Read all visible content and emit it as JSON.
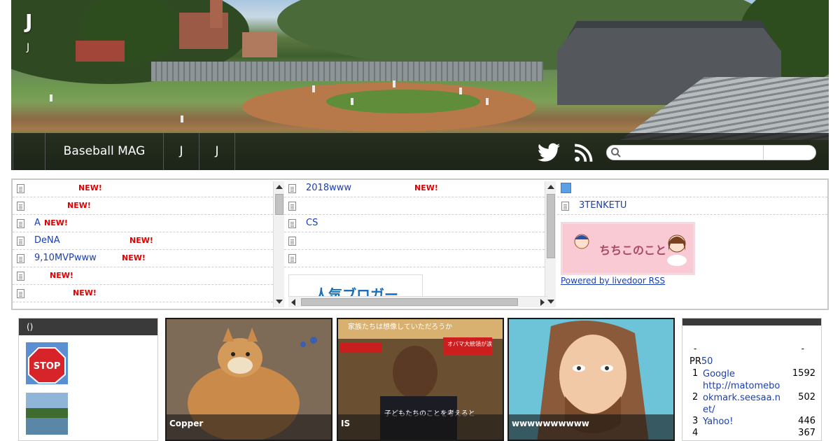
{
  "site": {
    "title": "J",
    "subtitle": "J"
  },
  "nav": {
    "items": [
      {
        "label": ""
      },
      {
        "label": "Baseball MAG"
      },
      {
        "label": "J"
      },
      {
        "label": "J"
      }
    ]
  },
  "search": {
    "placeholder": ""
  },
  "feed_left": [
    {
      "title": "",
      "badge": "NEW!"
    },
    {
      "title": "",
      "badge": "NEW!"
    },
    {
      "title": "A",
      "badge": "NEW!"
    },
    {
      "title": "DeNA",
      "badge": "NEW!"
    },
    {
      "title": "9,10MVPwww",
      "badge": "NEW!"
    },
    {
      "title": "",
      "badge": "NEW!"
    },
    {
      "title": "",
      "badge": "NEW!"
    }
  ],
  "feed_mid": [
    {
      "title": "2018www",
      "badge": "NEW!"
    },
    {
      "title": ""
    },
    {
      "title": "CS"
    },
    {
      "title": ""
    },
    {
      "title": ""
    }
  ],
  "ninki_banner": {
    "text": "人気ブロガー"
  },
  "feed_right": {
    "item": "3TENKETU",
    "banner_text": "ちちこのこと",
    "powered_by": "Powered by livedoor RSS"
  },
  "left_widget": {
    "title": "()"
  },
  "articles": [
    {
      "caption": "Copper"
    },
    {
      "caption": "IS",
      "image_text_top": "家族たちは想像していただろうか",
      "image_text_bottom": "子どもたちのことを考えると",
      "image_text_badge": "オバマ大統領が涙"
    },
    {
      "caption": "wwwwwwwwww"
    }
  ],
  "ranking": {
    "dash_left": "-",
    "dash_right": "-",
    "pr_label": "PR",
    "pr_count": "50",
    "rows": [
      {
        "rank": "1",
        "site": "Google",
        "count": "1592"
      },
      {
        "rank": "",
        "site": "http://matomebo",
        "count": ""
      },
      {
        "rank": "2",
        "site": "okmark.seesaa.n",
        "count": "502"
      },
      {
        "rank": "",
        "site": "et/",
        "count": ""
      },
      {
        "rank": "3",
        "site": "Yahoo!",
        "count": "446"
      },
      {
        "rank": "4",
        "site": "",
        "count": "367"
      }
    ]
  }
}
